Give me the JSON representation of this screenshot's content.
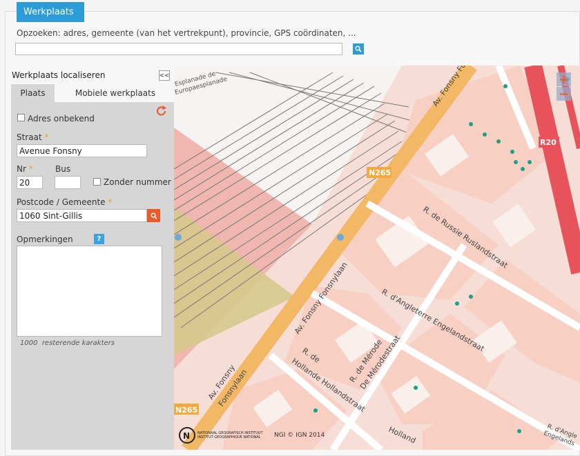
{
  "header": {
    "title": "Werkplaats"
  },
  "search": {
    "label": "Opzoeken: adres, gemeente (van het vertrekpunt), provincie, GPS coördinaten, ...",
    "value": ""
  },
  "left_panel": {
    "title": "Werkplaats localiseren",
    "collapse_label": "<<",
    "tabs": [
      {
        "label": "Plaats",
        "active": true
      },
      {
        "label": "Mobiele werkplaats",
        "active": false
      }
    ],
    "address_unknown_label": "Adres onbekend",
    "street_label": "Straat",
    "street_value": "Avenue Fonsny",
    "nr_label": "Nr",
    "nr_value": "20",
    "bus_label": "Bus",
    "bus_value": "",
    "no_number_label": "Zonder nummer",
    "postcode_label": "Postcode / Gemeente",
    "postcode_value": "1060 Sint-Gillis",
    "remarks_label": "Opmerkingen",
    "help_label": "?",
    "chars_count": "1000",
    "chars_label": "resterende karakters",
    "required_mark": "*"
  },
  "map": {
    "zoom_in": "+",
    "zoom_out": "−",
    "credit": "NGI © IGN 2014",
    "logo_line1": "NATIONAAL GEOGRAFISCH INSTITUUT",
    "logo_line2": "INSTITUT GEOGRAPHIQUE NATIONAL",
    "labels": {
      "esplanade1": "Esplanade de",
      "esplanade2": "Europaesplanade",
      "ave_fonsny_top": "Av. Fonsny Fo",
      "n265_top": "N265",
      "n265_bottom": "N265",
      "r20": "R20",
      "russie": "R. de Russie Ruslandstraat",
      "angleterre": "R. d'Angleterre Engelandstraat",
      "fonsny_main": "Av. Fonsny Fonsnylaan",
      "fonsny_low1": "Av. Fonsny",
      "fonsny_low2": "Fonsnylaan",
      "hollande1": "R. de",
      "hollande2": "Hollande Hollandstraat",
      "merode1": "R. de Mérode",
      "merode2": "De Mérodestraat",
      "angle_br1": "R. d'Angle",
      "angle_br2": "Engelands",
      "holland_bottom": "Holland"
    },
    "colors": {
      "road_major": "#f2b866",
      "road_ring": "#e8525a",
      "building": "#f8f0ec",
      "ground": "#f6ded6",
      "rail": "#888888",
      "tree": "#1aa085"
    }
  }
}
